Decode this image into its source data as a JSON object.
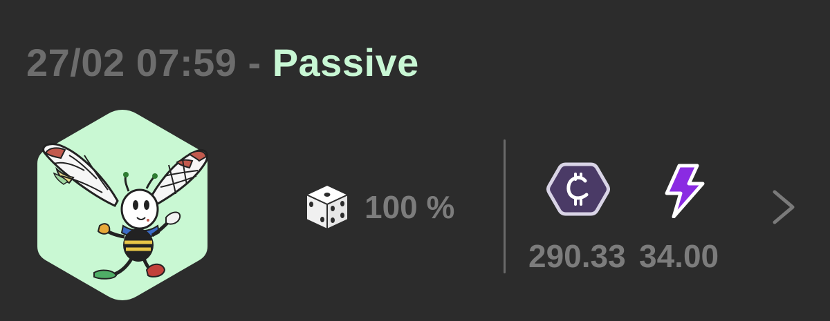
{
  "header": {
    "datetime": "27/02 07:59",
    "separator": " - ",
    "status": "Passive"
  },
  "character": {
    "icon": "bee-character-avatar",
    "background_color": "#c9f8d3"
  },
  "odds": {
    "icon": "dice-icon",
    "value": "100 %"
  },
  "rewards": [
    {
      "icon": "coin-hexagon-icon",
      "amount": "290.33",
      "color": "#4a3a66"
    },
    {
      "icon": "lightning-bolt-icon",
      "amount": "34.00",
      "color": "#8a2be2"
    }
  ],
  "navigation": {
    "icon": "chevron-right-icon"
  }
}
